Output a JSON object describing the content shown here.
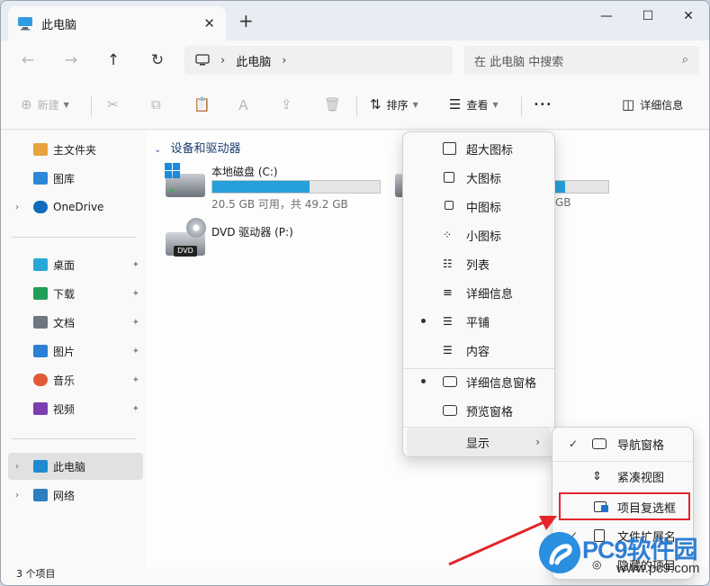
{
  "window": {
    "tab_title": "此电脑",
    "close_tab_glyph": "✕",
    "new_tab_glyph": "+",
    "minimize_glyph": "—",
    "maximize_glyph": "☐",
    "close_glyph": "✕"
  },
  "address": {
    "back_glyph": "←",
    "forward_glyph": "→",
    "up_glyph": "↑",
    "refresh_glyph": "↻",
    "crumb_separator": "›",
    "crumb": "此电脑",
    "trailing_separator": "›",
    "search_placeholder": "在 此电脑 中搜索",
    "search_glyph": "⌕"
  },
  "toolbar": {
    "new_label": "新建",
    "sort_label": "排序",
    "view_label": "查看",
    "more_label": "•••",
    "details_label": "详细信息",
    "cut_icon": "✂",
    "copy_icon": "⧉",
    "paste_icon": "📋",
    "rename_icon": "Ａ",
    "share_icon": "⇪",
    "delete_icon": "🗑"
  },
  "sidebar": {
    "items": [
      {
        "label": "主文件夹",
        "icon": "home-icon",
        "color": "#e8a33d"
      },
      {
        "label": "图库",
        "icon": "gallery-icon",
        "color": "#2b88d8"
      },
      {
        "label": "OneDrive",
        "icon": "cloud-icon",
        "color": "#0f6cbd"
      },
      {
        "label": "桌面",
        "icon": "desktop-icon",
        "color": "#2aa7d9"
      },
      {
        "label": "下载",
        "icon": "download-icon",
        "color": "#1e9e58"
      },
      {
        "label": "文档",
        "icon": "document-icon",
        "color": "#6d7780"
      },
      {
        "label": "图片",
        "icon": "picture-icon",
        "color": "#2b7fd4"
      },
      {
        "label": "音乐",
        "icon": "music-icon",
        "color": "#e05a3a"
      },
      {
        "label": "视频",
        "icon": "video-icon",
        "color": "#7b3fb0"
      },
      {
        "label": "此电脑",
        "icon": "computer-icon",
        "color": "#1f8ad2"
      },
      {
        "label": "网络",
        "icon": "network-icon",
        "color": "#2e7fbf"
      }
    ],
    "pin_glyph": "📌",
    "chevron_glyph": "›"
  },
  "content": {
    "group_title": "设备和驱动器",
    "group_chevron": "⌄",
    "drives": [
      {
        "name": "本地磁盘 (C:)",
        "free_text": "20.5 GB 可用，共 49.2 GB",
        "used_fraction": 0.583
      },
      {
        "name": "DVD 驱动器 (P:)",
        "badge": "DVD"
      }
    ],
    "second_drive_partial_text": "GB",
    "second_drive_used_fraction": 0.2
  },
  "status": {
    "count_text": "3 个项目"
  },
  "view_menu": {
    "items": [
      {
        "label": "超大图标",
        "icon": "extra-large-icons-icon",
        "bullet": false
      },
      {
        "label": "大图标",
        "icon": "large-icons-icon",
        "bullet": false
      },
      {
        "label": "中图标",
        "icon": "medium-icons-icon",
        "bullet": false
      },
      {
        "label": "小图标",
        "icon": "small-icons-icon",
        "bullet": false
      },
      {
        "label": "列表",
        "icon": "list-icon",
        "bullet": false
      },
      {
        "label": "详细信息",
        "icon": "details-icon",
        "bullet": false
      },
      {
        "label": "平铺",
        "icon": "tiles-icon",
        "bullet": true
      },
      {
        "label": "内容",
        "icon": "content-icon",
        "bullet": false
      },
      {
        "label": "详细信息窗格",
        "icon": "details-pane-icon",
        "bullet": true
      },
      {
        "label": "预览窗格",
        "icon": "preview-pane-icon",
        "bullet": false
      },
      {
        "label": "显示",
        "icon": "",
        "bullet": false
      }
    ],
    "submenu_arrow": "›"
  },
  "show_menu": {
    "items": [
      {
        "label": "导航窗格",
        "icon": "navigation-pane-icon",
        "checked": true
      },
      {
        "label": "紧凑视图",
        "icon": "compact-view-icon",
        "checked": false
      },
      {
        "label": "项目复选框",
        "icon": "item-checkbox-icon",
        "checked": false
      },
      {
        "label": "文件扩展名",
        "icon": "file-extension-icon",
        "checked": true
      },
      {
        "label": "隐藏的项目",
        "icon": "hidden-items-icon",
        "checked": false
      }
    ],
    "check_glyph": "✓"
  },
  "watermark": {
    "brand": "PC9软件园",
    "url": "www.pc9.com"
  }
}
